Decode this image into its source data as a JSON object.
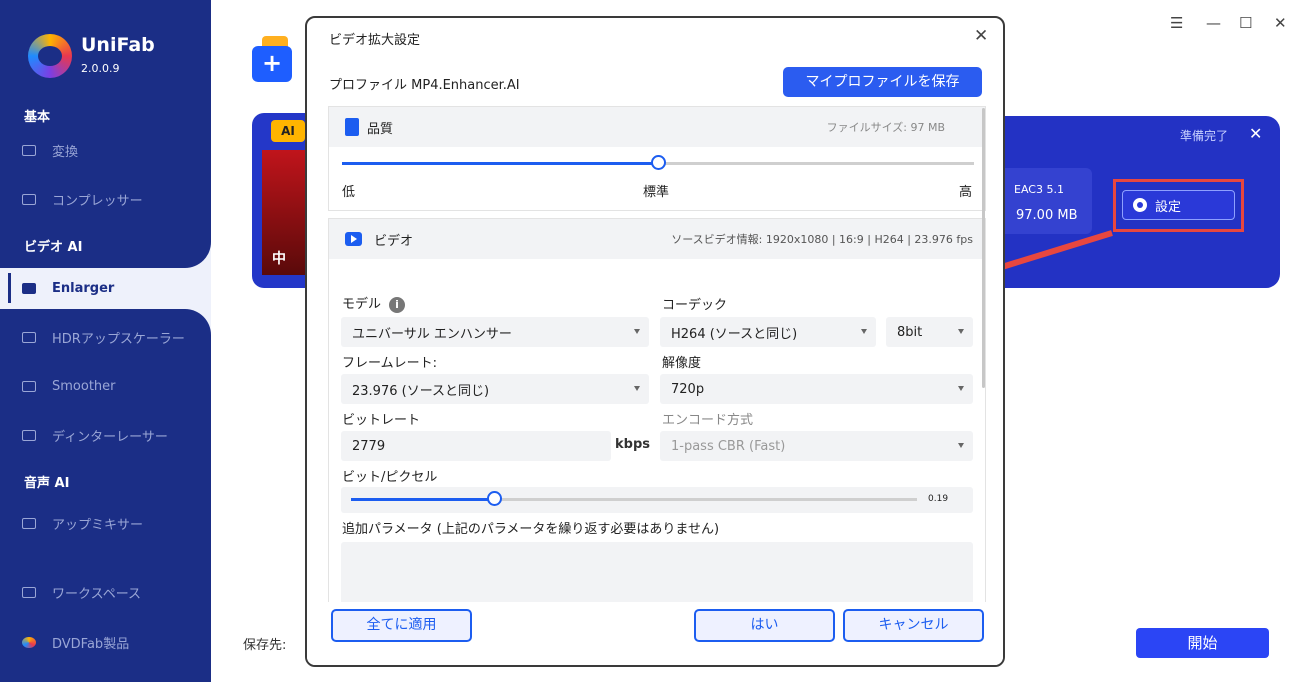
{
  "app": {
    "name": "UniFab",
    "version": "2.0.0.9"
  },
  "sidebar": {
    "sections": [
      "基本",
      "ビデオ AI",
      "音声 AI"
    ],
    "items": [
      {
        "label": "変換",
        "icon": "play-square-icon"
      },
      {
        "label": "コンプレッサー",
        "icon": "compress-icon"
      },
      {
        "label": "Enlarger",
        "icon": "enlarger-icon",
        "active": true
      },
      {
        "label": "HDRアップスケーラー",
        "icon": "hdr-icon"
      },
      {
        "label": "Smoother",
        "icon": "smoother-icon"
      },
      {
        "label": "ディンターレーサー",
        "icon": "deinterlace-icon"
      },
      {
        "label": "アップミキサー",
        "icon": "upmixer-icon"
      },
      {
        "label": "ワークスペース",
        "icon": "monitor-icon"
      },
      {
        "label": "DVDFab製品",
        "icon": "dvdfab-icon"
      }
    ]
  },
  "task": {
    "ai_badge": "AI",
    "thumb_text": "中",
    "status": "準備完了",
    "audio": "EAC3 5.1",
    "size": "97.00 MB",
    "settings_label": "設定"
  },
  "footer": {
    "save_to_label": "保存先:",
    "start_label": "開始"
  },
  "dialog": {
    "title": "ビデオ拡大設定",
    "profile_label": "プロファイル MP4.Enhancer.AI",
    "save_profile_label": "マイプロファイルを保存",
    "quality": {
      "title": "品質",
      "file_size": "ファイルサイズ:  97 MB",
      "low": "低",
      "standard": "標準",
      "high": "高",
      "level": 0.5
    },
    "video": {
      "title": "ビデオ",
      "source_info": "ソースビデオ情報: 1920x1080 | 16:9 | H264 | 23.976 fps",
      "model_label": "モデル",
      "model_value": "ユニバーサル エンハンサー",
      "codec_label": "コーデック",
      "codec_value": "H264 (ソースと同じ)",
      "bitdepth_value": "8bit",
      "framerate_label": "フレームレート:",
      "framerate_value": "23.976 (ソースと同じ)",
      "resolution_label": "解像度",
      "resolution_value": "720p",
      "bitrate_label": "ビットレート",
      "bitrate_value": "2779",
      "bitrate_unit": "kbps",
      "encode_label": "エンコード方式",
      "encode_value": "1-pass CBR (Fast)",
      "bpp_label": "ビット/ピクセル",
      "bpp_value": "0.19",
      "extra_params_label": "追加パラメータ (上記のパラメータを繰り返す必要はありません)"
    },
    "buttons": {
      "apply_all": "全てに適用",
      "yes": "はい",
      "cancel": "キャンセル"
    }
  },
  "colors": {
    "sidebar": "#1b2e86",
    "accent": "#1c5df0",
    "highlight": "#e8473f"
  }
}
